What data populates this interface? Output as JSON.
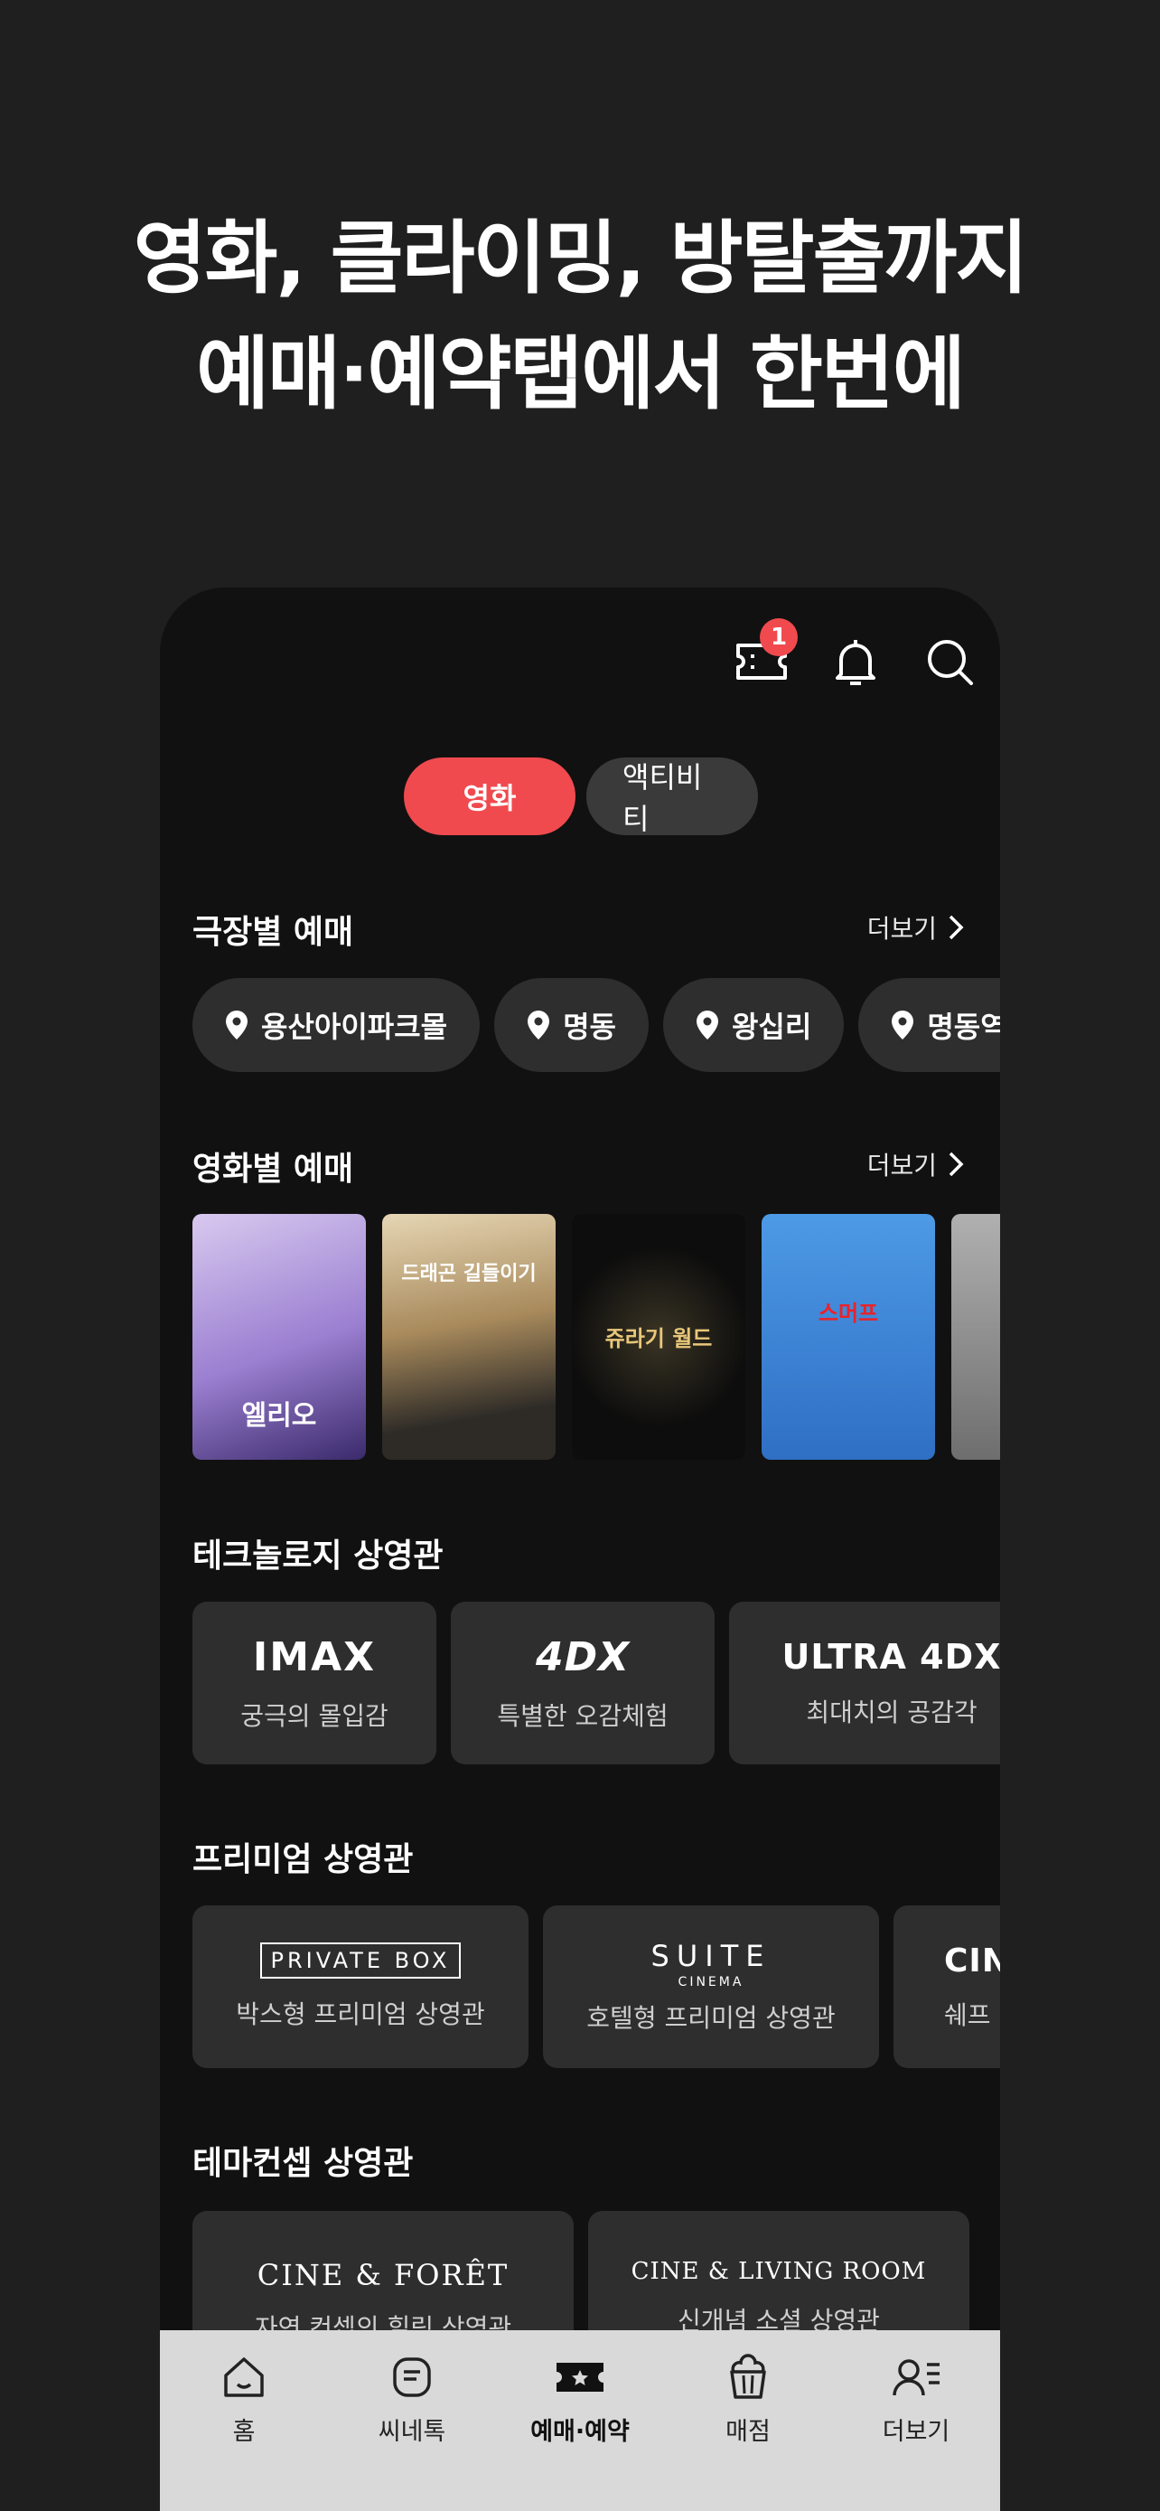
{
  "headline": {
    "line1": "영화, 클라이밍, 방탈출까지",
    "line2": "예매·예약탭에서 한번에"
  },
  "top_icons": {
    "ticket_badge": "1"
  },
  "segment": {
    "movie": "영화",
    "activity": "액티비티"
  },
  "theater_section": {
    "title": "극장별 예매",
    "more": "더보기",
    "chips": [
      "용산아이파크몰",
      "명동",
      "왕십리",
      "명동역 씨네라이브러리"
    ]
  },
  "movie_section": {
    "title": "영화별 예매",
    "more": "더보기",
    "posters": [
      {
        "title": "엘리오",
        "color": "#c9b6e6"
      },
      {
        "title": "드래곤 길들이기",
        "color": "#b8a27c"
      },
      {
        "title": "쥬라기 월드",
        "color": "#0d0d0d"
      },
      {
        "title": "스머프",
        "color": "#3a86d9"
      },
      {
        "title": "",
        "color": "#8b8b8b"
      }
    ]
  },
  "tech_section": {
    "title": "테크놀로지 상영관",
    "cards": [
      {
        "logo": "IMAX",
        "sub": "궁극의 몰입감"
      },
      {
        "logo": "4DX",
        "sub": "특별한 오감체험"
      },
      {
        "logo": "ULTRA 4DX",
        "sub": "최대치의 공감각"
      }
    ]
  },
  "premium_section": {
    "title": "프리미엄 상영관",
    "cards": [
      {
        "logo": "PRIVATE BOX",
        "sub": "박스형 프리미엄 상영관"
      },
      {
        "logo": "SUITE",
        "logo_sub": "CINEMA",
        "sub": "호텔형 프리미엄 상영관"
      },
      {
        "logo": "CIN",
        "sub": "쉐프"
      }
    ]
  },
  "theme_section": {
    "title": "테마컨셉 상영관",
    "cards": [
      {
        "logo": "CINE & FORÊT",
        "sub": "자연 컨셉의 힐링 상영관"
      },
      {
        "logo": "CINE & LIVING ROOM",
        "sub": "신개념 소셜 상영관"
      }
    ]
  },
  "tabbar": {
    "home": "홈",
    "cinetalk": "씨네톡",
    "booking": "예매·예약",
    "store": "매점",
    "more": "더보기"
  },
  "colors": {
    "accent": "#f04a4f",
    "card": "#2e2e2e",
    "tabbar": "#d9d9d9"
  }
}
